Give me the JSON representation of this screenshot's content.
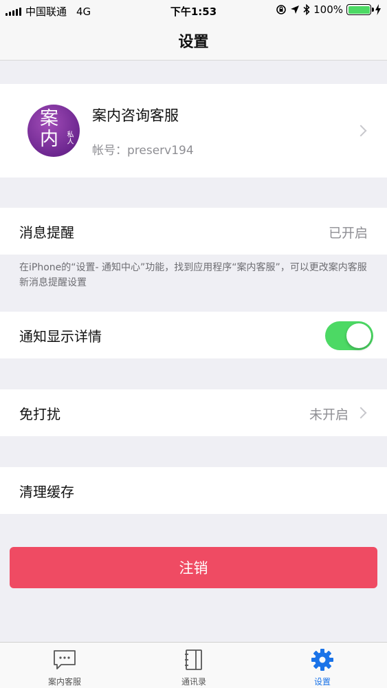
{
  "status_bar": {
    "carrier": "中国联通",
    "network": "4G",
    "time": "下午1:53",
    "battery": "100%"
  },
  "nav": {
    "title": "设置"
  },
  "profile": {
    "avatar_line1": "案",
    "avatar_line2": "内",
    "avatar_small": "私人",
    "name": "案内咨询客服",
    "account": "帐号：preserv194"
  },
  "settings": {
    "notification": {
      "label": "消息提醒",
      "value": "已开启"
    },
    "hint": "在iPhone的“设置- 通知中心”功能，找到应用程序“案内客服”，可以更改案内客服新消息提醒设置",
    "show_details": {
      "label": "通知显示详情",
      "enabled": true
    },
    "do_not_disturb": {
      "label": "免打扰",
      "value": "未开启"
    },
    "clear_cache": {
      "label": "清理缓存"
    }
  },
  "logout": {
    "label": "注销"
  },
  "tabs": [
    {
      "label": "案内客服",
      "icon": "chat-bubble-icon",
      "active": false
    },
    {
      "label": "通讯录",
      "icon": "address-book-icon",
      "active": false
    },
    {
      "label": "设置",
      "icon": "gear-icon",
      "active": true
    }
  ],
  "colors": {
    "accent": "#1a73e8",
    "toggle_on": "#4cd964",
    "logout": "#ef4b63"
  }
}
